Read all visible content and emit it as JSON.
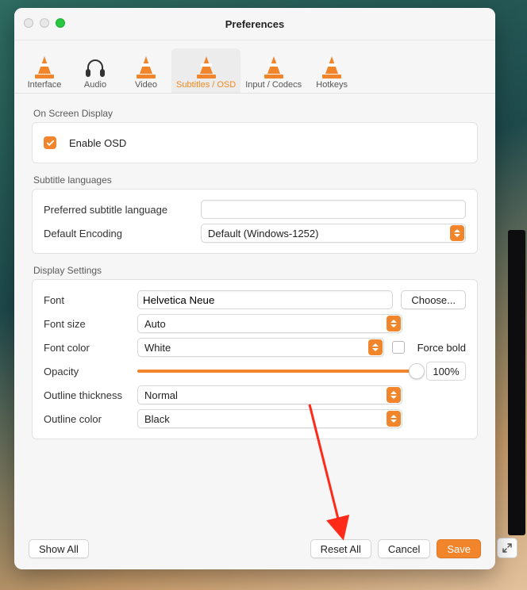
{
  "window": {
    "title": "Preferences"
  },
  "tabs": [
    {
      "label": "Interface"
    },
    {
      "label": "Audio"
    },
    {
      "label": "Video"
    },
    {
      "label": "Subtitles / OSD"
    },
    {
      "label": "Input / Codecs"
    },
    {
      "label": "Hotkeys"
    }
  ],
  "sections": {
    "osd": {
      "title": "On Screen Display",
      "enable_label": "Enable OSD",
      "enable_checked": true
    },
    "langs": {
      "title": "Subtitle languages",
      "preferred_label": "Preferred subtitle language",
      "preferred_value": "",
      "encoding_label": "Default Encoding",
      "encoding_value": "Default (Windows-1252)"
    },
    "display": {
      "title": "Display Settings",
      "font_label": "Font",
      "font_value": "Helvetica Neue",
      "choose_label": "Choose...",
      "size_label": "Font size",
      "size_value": "Auto",
      "color_label": "Font color",
      "color_value": "White",
      "force_bold_label": "Force bold",
      "force_bold_checked": false,
      "opacity_label": "Opacity",
      "opacity_value": "100%",
      "outline_thick_label": "Outline thickness",
      "outline_thick_value": "Normal",
      "outline_color_label": "Outline color",
      "outline_color_value": "Black"
    }
  },
  "footer": {
    "show_all": "Show All",
    "reset_all": "Reset All",
    "cancel": "Cancel",
    "save": "Save"
  }
}
